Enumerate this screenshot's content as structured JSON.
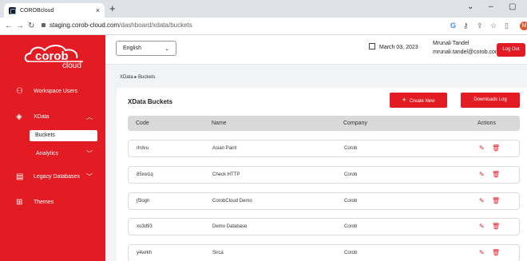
{
  "browser": {
    "tab_title": "COROBcloud",
    "tab_close": "×",
    "new_tab": "+",
    "url_host": "staging.corob-cloud.com",
    "url_path": "/dashboard/xdata/buckets",
    "profile_initial": "M",
    "win_minimize": "–",
    "win_restore": "▢",
    "win_dropdown": "⌄"
  },
  "sidebar": {
    "logo_main": "corob",
    "logo_sub": "cloud",
    "items": [
      {
        "label": "Workspace Users",
        "icon": "users-icon"
      },
      {
        "label": "XData",
        "icon": "layers-icon"
      },
      {
        "label": "Legacy Databases",
        "icon": "database-icon"
      },
      {
        "label": "Themes",
        "icon": "grid-icon"
      }
    ],
    "xdata_sub": {
      "buckets": "Buckets",
      "analytics": "Analytics"
    }
  },
  "header": {
    "language": "English",
    "date": "March 03, 2023",
    "user_name": "Mrunali Tandel",
    "user_email": "mrunali.tandel@corob.com",
    "logout": "Log Out"
  },
  "breadcrumb": {
    "root": "XData",
    "separator": "▸",
    "current": "Buckets"
  },
  "main": {
    "title": "XData Buckets",
    "create_new": "Create New",
    "create_plus": "+",
    "downloads_log": "Downloads Log",
    "columns": [
      "Code",
      "Name",
      "Company",
      "Actions"
    ],
    "rows": [
      {
        "code": "rlrdvu",
        "name": "Asian Paint",
        "company": "Corob"
      },
      {
        "code": "85xw1q",
        "name": "Check HTTP",
        "company": "Corob"
      },
      {
        "code": "jf3ogn",
        "name": "CorobCloud Demo",
        "company": "Corob"
      },
      {
        "code": "xo3d93",
        "name": "Demo Database",
        "company": "Corob"
      },
      {
        "code": "y4wrkh",
        "name": "Sirca",
        "company": "Corob"
      }
    ]
  },
  "colors": {
    "brand": "#e31b23",
    "header_row": "#d9d9d9"
  }
}
